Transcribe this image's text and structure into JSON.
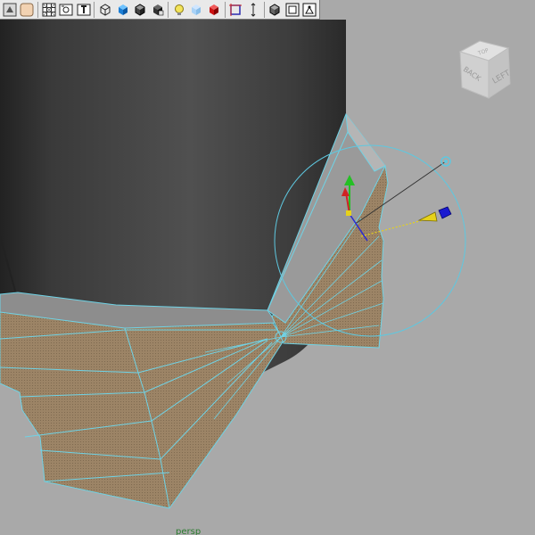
{
  "app": {
    "camera_label": "persp"
  },
  "viewcube": {
    "faces": [
      "BACK",
      "LEFT",
      "TOP"
    ]
  },
  "toolbar": {
    "buttons": [
      {
        "icon": "select-camera-icon"
      },
      {
        "icon": "camera-attributes-icon"
      },
      {
        "icon": "bookmarks-icon"
      },
      {
        "icon": "image-plane-icon"
      },
      {
        "icon": "grid-icon"
      },
      {
        "icon": "film-gate-icon"
      },
      {
        "icon": "resolution-gate-icon"
      },
      {
        "icon": "wireframe-icon"
      },
      {
        "icon": "smooth-shade-icon"
      },
      {
        "icon": "wireframe-on-shaded-icon"
      },
      {
        "icon": "default-material-icon"
      },
      {
        "icon": "use-all-lights-icon"
      },
      {
        "icon": "xray-icon"
      },
      {
        "icon": "shadows-icon"
      },
      {
        "icon": "isolate-select-icon"
      },
      {
        "icon": "xray-joints-icon"
      },
      {
        "icon": "resolution-gate-frame-icon"
      },
      {
        "icon": "safe-action-icon"
      }
    ]
  },
  "colors": {
    "viewport_bg": "#a9a9a9",
    "wire": "#6fd3e6",
    "mesh_fill": "#9a8466",
    "object_dark": "#3f3f3f",
    "manipulator_circle": "#5ec8e0",
    "light_cone": "#e6d21a",
    "light_target": "#1a1ad0"
  }
}
